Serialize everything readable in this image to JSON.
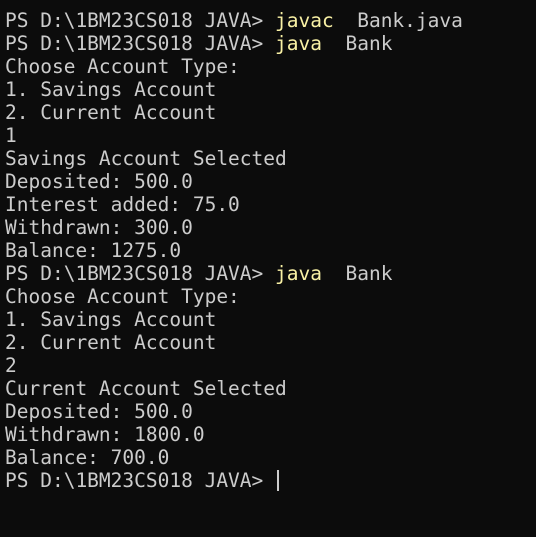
{
  "colors": {
    "background": "#0c0c0c",
    "text": "#cccccc",
    "command": "#f9f1a5"
  },
  "terminal": {
    "prompt": "PS D:\\1BM23CS018 JAVA> ",
    "commands": [
      {
        "command": "javac",
        "args": "  Bank.java"
      },
      {
        "command": "java",
        "args": "  Bank"
      },
      {
        "command": "java",
        "args": "  Bank"
      }
    ],
    "run1": {
      "output": [
        "Choose Account Type:",
        "1. Savings Account",
        "2. Current Account",
        "1",
        "Savings Account Selected",
        "Deposited: 500.0",
        "Interest added: 75.0",
        "Withdrawn: 300.0",
        "Balance: 1275.0"
      ]
    },
    "run2": {
      "output": [
        "Choose Account Type:",
        "1. Savings Account",
        "2. Current Account",
        "2",
        "Current Account Selected",
        "Deposited: 500.0",
        "Withdrawn: 1800.0",
        "Balance: 700.0"
      ]
    },
    "final_prompt": "PS D:\\1BM23CS018 JAVA> "
  }
}
